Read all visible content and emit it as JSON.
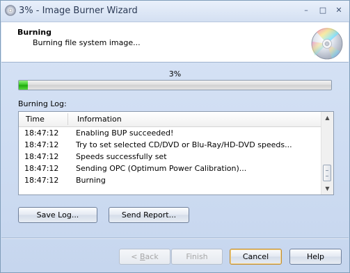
{
  "window": {
    "title": "3% - Image Burner Wizard",
    "controls": {
      "minimize": "–",
      "maximize": "□",
      "close": "✕"
    }
  },
  "header": {
    "title": "Burning",
    "subtitle": "Burning file system image...",
    "icon": "disc-icon"
  },
  "progress": {
    "label": "3%",
    "value": 0.03,
    "color": "#32c21d"
  },
  "log": {
    "label": "Burning Log:",
    "columns": [
      "Time",
      "Information"
    ],
    "rows": [
      {
        "time": "18:47:12",
        "info": "Enabling BUP succeeded!"
      },
      {
        "time": "18:47:12",
        "info": "Try to set selected CD/DVD or Blu-Ray/HD-DVD speeds..."
      },
      {
        "time": "18:47:12",
        "info": "Speeds successfully set"
      },
      {
        "time": "18:47:12",
        "info": "Sending OPC (Optimum Power Calibration)..."
      },
      {
        "time": "18:47:12",
        "info": "Burning"
      }
    ]
  },
  "buttons": {
    "save_log": "Save Log...",
    "send_report": "Send Report...",
    "back_prefix": "< ",
    "back_key": "B",
    "back_suffix": "ack",
    "finish": "Finish",
    "cancel": "Cancel",
    "help": "Help"
  }
}
